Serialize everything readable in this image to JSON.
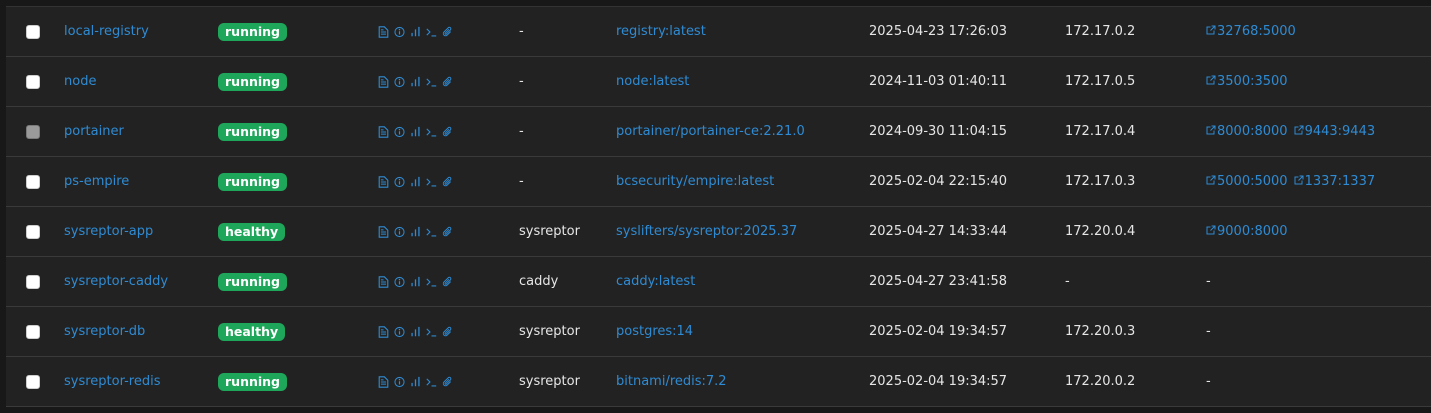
{
  "rows": [
    {
      "name": "local-registry",
      "state": "running",
      "stack": "-",
      "image": "registry:latest",
      "created": "2025-04-23 17:26:03",
      "ip": "172.17.0.2",
      "ports": [
        "32768:5000"
      ],
      "disabled": false
    },
    {
      "name": "node",
      "state": "running",
      "stack": "-",
      "image": "node:latest",
      "created": "2024-11-03 01:40:11",
      "ip": "172.17.0.5",
      "ports": [
        "3500:3500"
      ],
      "disabled": false
    },
    {
      "name": "portainer",
      "state": "running",
      "stack": "-",
      "image": "portainer/portainer-ce:2.21.0",
      "created": "2024-09-30 11:04:15",
      "ip": "172.17.0.4",
      "ports": [
        "8000:8000",
        "9443:9443"
      ],
      "disabled": true
    },
    {
      "name": "ps-empire",
      "state": "running",
      "stack": "-",
      "image": "bcsecurity/empire:latest",
      "created": "2025-02-04 22:15:40",
      "ip": "172.17.0.3",
      "ports": [
        "5000:5000",
        "1337:1337"
      ],
      "disabled": false
    },
    {
      "name": "sysreptor-app",
      "state": "healthy",
      "stack": "sysreptor",
      "image": "syslifters/sysreptor:2025.37",
      "created": "2025-04-27 14:33:44",
      "ip": "172.20.0.4",
      "ports": [
        "9000:8000"
      ],
      "disabled": false
    },
    {
      "name": "sysreptor-caddy",
      "state": "running",
      "stack": "caddy",
      "image": "caddy:latest",
      "created": "2025-04-27 23:41:58",
      "ip": "-",
      "ports": [],
      "disabled": false
    },
    {
      "name": "sysreptor-db",
      "state": "healthy",
      "stack": "sysreptor",
      "image": "postgres:14",
      "created": "2025-02-04 19:34:57",
      "ip": "172.20.0.3",
      "ports": [],
      "disabled": false
    },
    {
      "name": "sysreptor-redis",
      "state": "running",
      "stack": "sysreptor",
      "image": "bitnami/redis:7.2",
      "created": "2025-02-04 19:34:57",
      "ip": "172.20.0.2",
      "ports": [],
      "disabled": false
    }
  ],
  "quick_actions": [
    "logs-icon",
    "inspect-icon",
    "stats-icon",
    "console-icon",
    "attach-icon"
  ],
  "empty_ports_text": "-",
  "colors": {
    "link": "#2f8bd3",
    "badge": "#1ea75a",
    "row_bg": "#222222",
    "divider": "#3a3a3a"
  }
}
